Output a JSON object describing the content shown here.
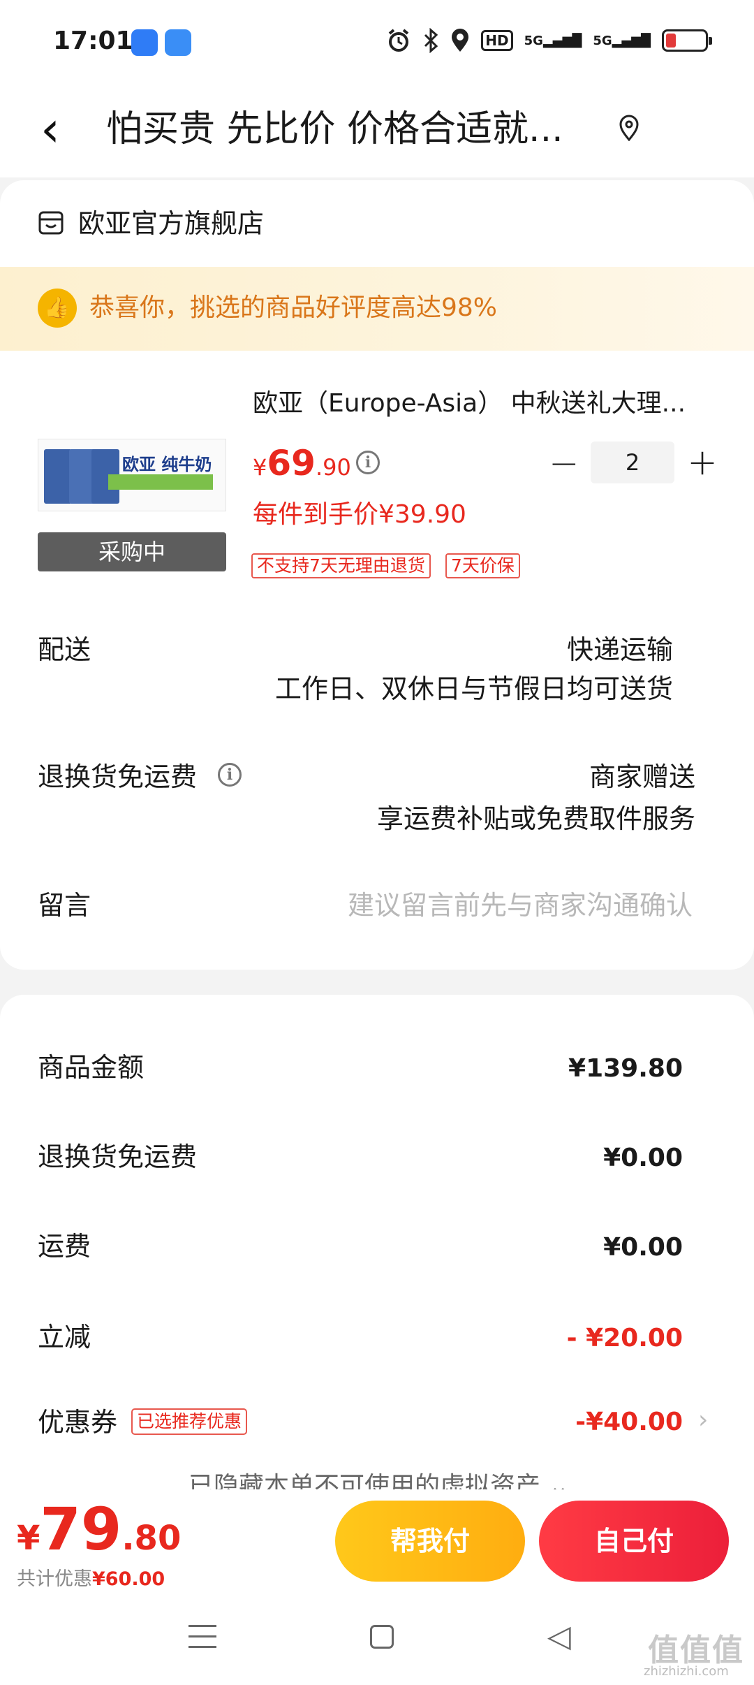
{
  "status_bar": {
    "time": "17:01",
    "icons": [
      "alarm-icon",
      "bluetooth-icon",
      "location-icon",
      "hd-icon",
      "5g-signal-icon",
      "5g-signal-icon",
      "battery-icon"
    ],
    "hd": "HD",
    "net1": "5G",
    "net2": "5G"
  },
  "header": {
    "title": "怕买贵 先比价 价格合适就...",
    "back_icon": "‹",
    "location_icon": "location-pin-icon"
  },
  "store": {
    "name": "欧亚官方旗舰店"
  },
  "promo": {
    "text": "恭喜你，挑选的商品好评度高达98%"
  },
  "product": {
    "name": "欧亚（Europe-Asia） 中秋送礼大理...",
    "image_brand": "欧亚 纯牛奶",
    "status": "采购中",
    "price_symbol": "¥",
    "price_int": "69",
    "price_dec": ".90",
    "unit_price": "每件到手价¥39.90",
    "tags": [
      "不支持7天无理由退货",
      "7天价保"
    ],
    "quantity": "2",
    "minus": "−",
    "plus": "+"
  },
  "delivery": {
    "label": "配送",
    "method": "快递运输",
    "days": "工作日、双休日与节假日均可送货"
  },
  "return_shipping": {
    "label": "退换货免运费",
    "gift": "商家赠送",
    "service": "享运费补贴或免费取件服务"
  },
  "message": {
    "label": "留言",
    "placeholder": "建议留言前先与商家沟通确认"
  },
  "summary": {
    "goods_label": "商品金额",
    "goods_value": "¥139.80",
    "return_label": "退换货免运费",
    "return_value": "¥0.00",
    "shipping_label": "运费",
    "shipping_value": "¥0.00",
    "instant_label": "立减",
    "instant_value": "- ¥20.00",
    "coupon_label": "优惠券",
    "coupon_tag": "已选推荐优惠",
    "coupon_value": "-¥40.00",
    "hidden_assets": "已隐藏本单不可使用的虚拟资产 ⌄"
  },
  "bottom": {
    "total_symbol": "¥",
    "total_int": "79",
    "total_dec": ".80",
    "discount_label": "共计优惠",
    "discount_value": "¥60.00",
    "help_pay": "帮我付",
    "self_pay": "自己付"
  },
  "watermark": {
    "text": "值值值",
    "url": "zhizhizhi.com"
  },
  "colors": {
    "accent_red": "#e8281e",
    "promo_orange": "#d9761a",
    "button_yellow": "#ffb914",
    "button_red": "#f0283e"
  }
}
